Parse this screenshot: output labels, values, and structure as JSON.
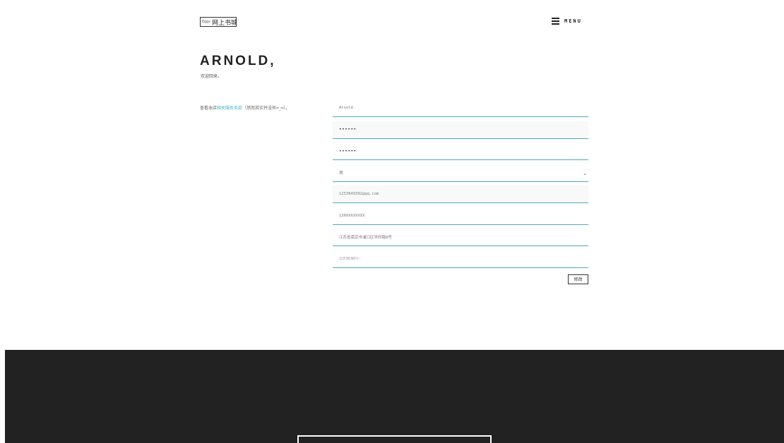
{
  "header": {
    "logo_small": "Eggs",
    "logo_main": "网上书城",
    "menu_label": "MENU"
  },
  "greeting": {
    "name": "ARNOLD,",
    "subtitle": "欢迎回来。"
  },
  "terms": {
    "prefix": "查看本店",
    "link": "相关服务条款",
    "suffix": "（然而其实并没有━_━）。"
  },
  "form": {
    "username": "Arnold",
    "password": "••••••",
    "password_confirm": "••••••",
    "gender": "男",
    "email": "1253649392@qq.com",
    "phone": "1360XXXXXXX",
    "address": "江苏省南京市浦口区学府路8号",
    "zip_placeholder": "您的邮编吗~",
    "submit_label": "修改"
  }
}
